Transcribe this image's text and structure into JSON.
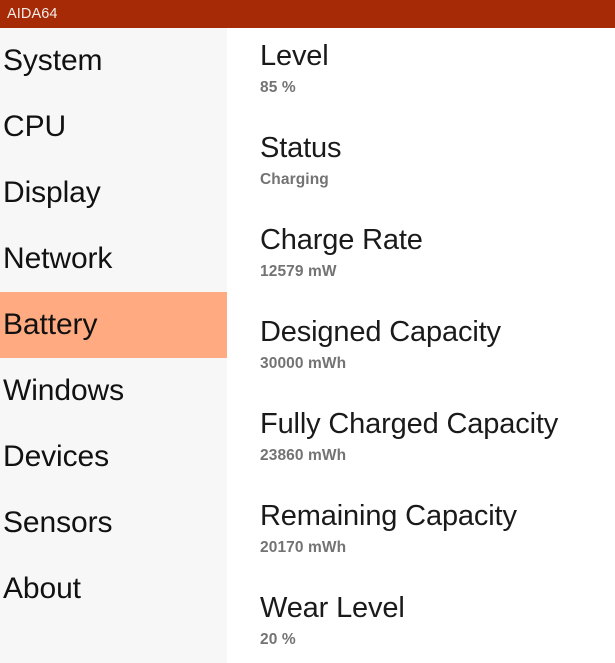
{
  "window": {
    "title": "AIDA64",
    "accent_color": "#a62a06",
    "selection_color": "#ffaa80",
    "sidebar_bg": "#f7f7f7",
    "content_bg": "#ffffff"
  },
  "sidebar": {
    "items": [
      {
        "label": "System",
        "selected": false
      },
      {
        "label": "CPU",
        "selected": false
      },
      {
        "label": "Display",
        "selected": false
      },
      {
        "label": "Network",
        "selected": false
      },
      {
        "label": "Battery",
        "selected": true
      },
      {
        "label": "Windows",
        "selected": false
      },
      {
        "label": "Devices",
        "selected": false
      },
      {
        "label": "Sensors",
        "selected": false
      },
      {
        "label": "About",
        "selected": false
      }
    ]
  },
  "main": {
    "page": "Battery",
    "entries": [
      {
        "label": "Level",
        "value": "85 %"
      },
      {
        "label": "Status",
        "value": "Charging"
      },
      {
        "label": "Charge Rate",
        "value": "12579 mW"
      },
      {
        "label": "Designed Capacity",
        "value": "30000 mWh"
      },
      {
        "label": "Fully Charged Capacity",
        "value": "23860 mWh"
      },
      {
        "label": "Remaining Capacity",
        "value": "20170 mWh"
      },
      {
        "label": "Wear Level",
        "value": "20 %"
      }
    ]
  }
}
